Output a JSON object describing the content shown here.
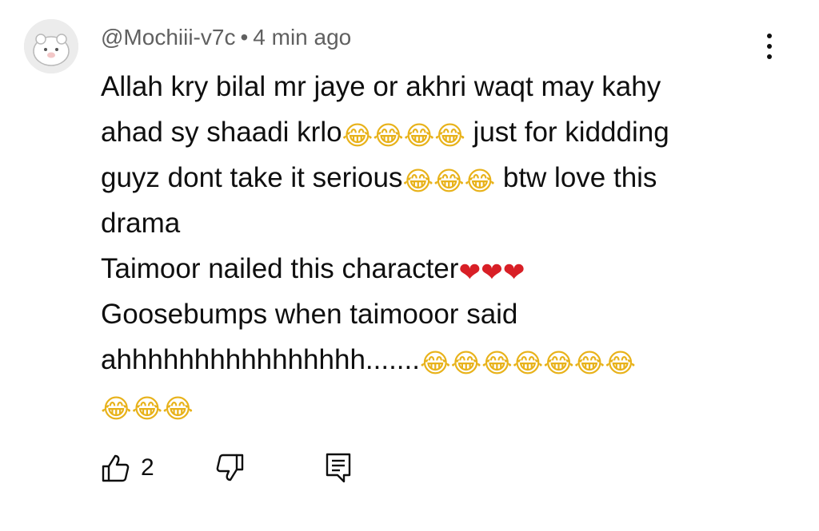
{
  "comment": {
    "author": "@Mochiii-v7c",
    "separator": "•",
    "time": "4 min ago",
    "lines": [
      {
        "text": "Allah kry bilal mr jaye or akhri waqt may kahy",
        "emoji_before": [],
        "text2": "",
        "emoji_after": [],
        "text3": ""
      },
      {
        "text": "ahad sy shaadi krlo",
        "emoji_after": [
          "😂",
          "😂",
          "😂",
          "😂"
        ],
        "text2": " just for kiddding"
      },
      {
        "text": "guyz dont take it serious",
        "emoji_after": [
          "😂",
          "😂",
          "😂"
        ],
        "text2": " btw love this"
      },
      {
        "text": "drama"
      },
      {
        "text": "Taimoor nailed this character",
        "emoji_after": [
          "❤",
          "❤",
          "❤"
        ]
      },
      {
        "text": "Goosebumps when taimooor said"
      },
      {
        "text": "ahhhhhhhhhhhhhhhh.......",
        "emoji_after": [
          "😂",
          "😂",
          "😂",
          "😂",
          "😂",
          "😂",
          "😂"
        ]
      },
      {
        "text": "",
        "emoji_after": [
          "😂",
          "😂",
          "😂"
        ]
      }
    ]
  },
  "actions": {
    "like_count": "2"
  },
  "icons": {
    "more": "more-vertical-icon",
    "like": "thumbs-up-icon",
    "dislike": "thumbs-down-icon",
    "reply": "reply-comment-icon"
  },
  "colors": {
    "meta_text": "#606060",
    "body_text": "#0f0f0f",
    "laugh_emoji": "#e8b21a",
    "heart_emoji": "#d81f26"
  }
}
